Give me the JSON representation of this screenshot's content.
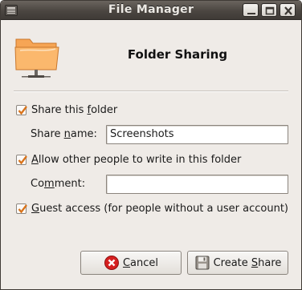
{
  "window": {
    "title": "File Manager"
  },
  "header": {
    "title": "Folder Sharing",
    "icon": "shared-folder-icon"
  },
  "share_folder": {
    "checked": true,
    "label_pre": "Share this ",
    "label_mnemonic": "f",
    "label_post": "older"
  },
  "share_name": {
    "label_pre": "Share ",
    "label_mnemonic": "n",
    "label_post": "ame:",
    "value": "Screenshots"
  },
  "allow_write": {
    "checked": true,
    "label_mnemonic": "A",
    "label_post": "llow other people to write in this folder"
  },
  "comment": {
    "label_pre": "Co",
    "label_mnemonic": "m",
    "label_post": "ment:",
    "value": ""
  },
  "guest_access": {
    "checked": true,
    "label_mnemonic": "G",
    "label_post": "uest access (for people without a user account)"
  },
  "buttons": {
    "cancel": {
      "mnemonic": "C",
      "label_post": "ancel",
      "icon": "cancel-icon"
    },
    "create": {
      "label_pre": "Create ",
      "mnemonic": "S",
      "label_post": "hare",
      "icon": "floppy-disk-icon"
    }
  },
  "colors": {
    "folder": "#f7a24a",
    "cancel_red": "#d21f1f",
    "checkmark": "#e07b14"
  }
}
